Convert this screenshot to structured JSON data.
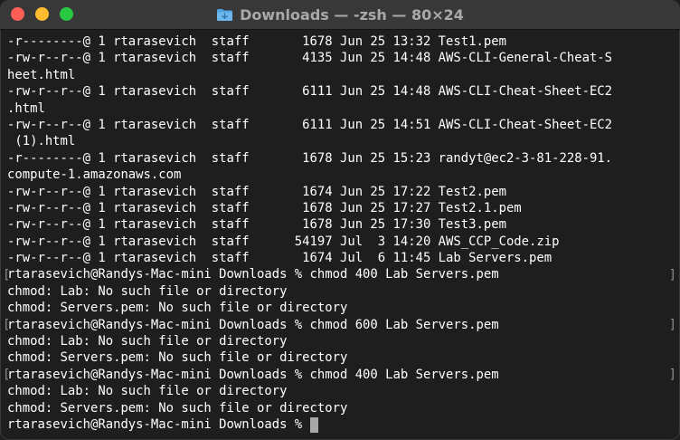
{
  "window": {
    "title": "Downloads — -zsh — 80×24",
    "folder_icon": "folder-icon",
    "colors": {
      "close": "#ff5f57",
      "minimize": "#febc2e",
      "maximize": "#28c840",
      "background": "#1e1e1e",
      "titlebar": "#383838"
    }
  },
  "terminal": {
    "lines": [
      "-r--------@ 1 rtarasevich  staff       1678 Jun 25 13:32 Test1.pem",
      "-rw-r--r--@ 1 rtarasevich  staff       4135 Jun 25 14:48 AWS-CLI-General-Cheat-S",
      "heet.html",
      "-rw-r--r--@ 1 rtarasevich  staff       6111 Jun 25 14:48 AWS-CLI-Cheat-Sheet-EC2",
      ".html",
      "-rw-r--r--@ 1 rtarasevich  staff       6111 Jun 25 14:51 AWS-CLI-Cheat-Sheet-EC2",
      " (1).html",
      "-r--------@ 1 rtarasevich  staff       1678 Jun 25 15:23 randyt@ec2-3-81-228-91.",
      "compute-1.amazonaws.com",
      "-rw-r--r--@ 1 rtarasevich  staff       1674 Jun 25 17:22 Test2.pem",
      "-rw-r--r--@ 1 rtarasevich  staff       1678 Jun 25 17:27 Test2.1.pem",
      "-rw-r--r--@ 1 rtarasevich  staff       1678 Jun 25 17:30 Test3.pem",
      "-rw-r--r--@ 1 rtarasevich  staff      54197 Jul  3 14:20 AWS_CCP_Code.zip",
      "-rw-r--r--@ 1 rtarasevich  staff       1674 Jul  6 11:45 Lab Servers.pem",
      "rtarasevich@Randys-Mac-mini Downloads % chmod 400 Lab Servers.pem",
      "chmod: Lab: No such file or directory",
      "chmod: Servers.pem: No such file or directory",
      "rtarasevich@Randys-Mac-mini Downloads % chmod 600 Lab Servers.pem",
      "chmod: Lab: No such file or directory",
      "chmod: Servers.pem: No such file or directory",
      "rtarasevich@Randys-Mac-mini Downloads % chmod 400 Lab Servers.pem",
      "chmod: Lab: No such file or directory",
      "chmod: Servers.pem: No such file or directory",
      "rtarasevich@Randys-Mac-mini Downloads % "
    ],
    "prompt_mark_left": "[",
    "prompt_mark_right": "]"
  }
}
